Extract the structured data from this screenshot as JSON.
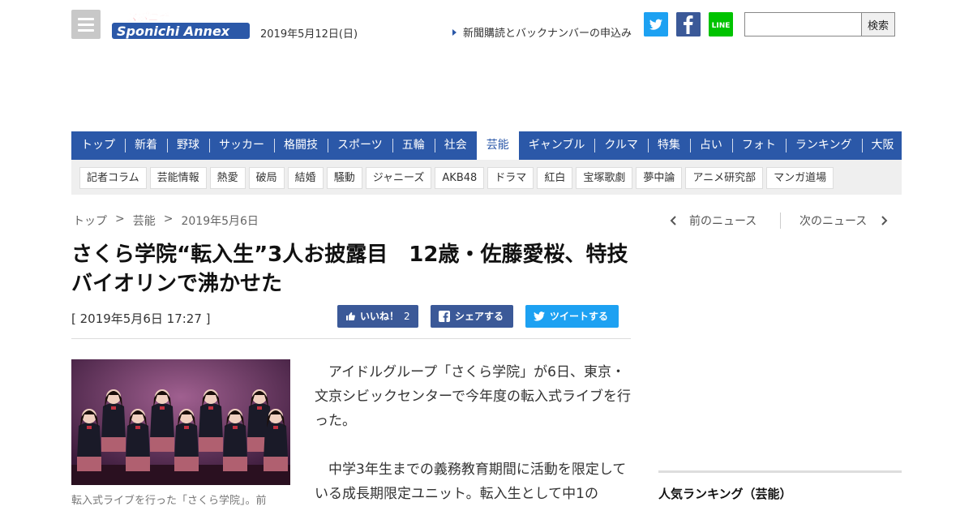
{
  "header": {
    "logo_text": "Sponichi Annex",
    "logo_kana": "スポニチ",
    "date": "2019年5月12日(日)",
    "subscribe_link": "新聞購読とバックナンバーの申込み",
    "search_button": "検索",
    "search_value": ""
  },
  "nav": {
    "items": [
      "トップ",
      "新着",
      "野球",
      "サッカー",
      "格闘技",
      "スポーツ",
      "五輪",
      "社会",
      "芸能",
      "ギャンブル",
      "クルマ",
      "特集",
      "占い",
      "フォト",
      "ランキング",
      "大阪"
    ],
    "active": "芸能"
  },
  "subnav": {
    "items": [
      "記者コラム",
      "芸能情報",
      "熱愛",
      "破局",
      "結婚",
      "騒動",
      "ジャニーズ",
      "AKB48",
      "ドラマ",
      "紅白",
      "宝塚歌劇",
      "夢中論",
      "アニメ研究部",
      "マンガ道場"
    ]
  },
  "breadcrumb": [
    "トップ",
    ">",
    "芸能",
    ">",
    "2019年5月6日"
  ],
  "pager": {
    "prev": "前のニュース",
    "next": "次のニュース"
  },
  "article": {
    "title": "さくら学院“転入生”3人お披露目　12歳・佐藤愛桜、特技バイオリンで沸かせた",
    "timestamp": "[ 2019年5月6日 17:27 ]",
    "like_label": "いいね！",
    "like_count": "2",
    "fb_share": "シェアする",
    "tweet": "ツイートする",
    "caption": "転入式ライブを行った「さくら学院」。前",
    "paragraphs": [
      "アイドルグループ「さくら学院」が6日、東京・文京シビックセンターで今年度の転入式ライブを行った。",
      "中学3年生までの義務教育期間に活動を限定している成長期限定ユニット。転入生として中1の"
    ]
  },
  "sidebar": {
    "ranking_title": "人気ランキング（芸能）"
  },
  "colors": {
    "nav_bg": "#2b58a8",
    "twitter": "#1da1f2",
    "facebook": "#3b5998",
    "line": "#00c300"
  }
}
